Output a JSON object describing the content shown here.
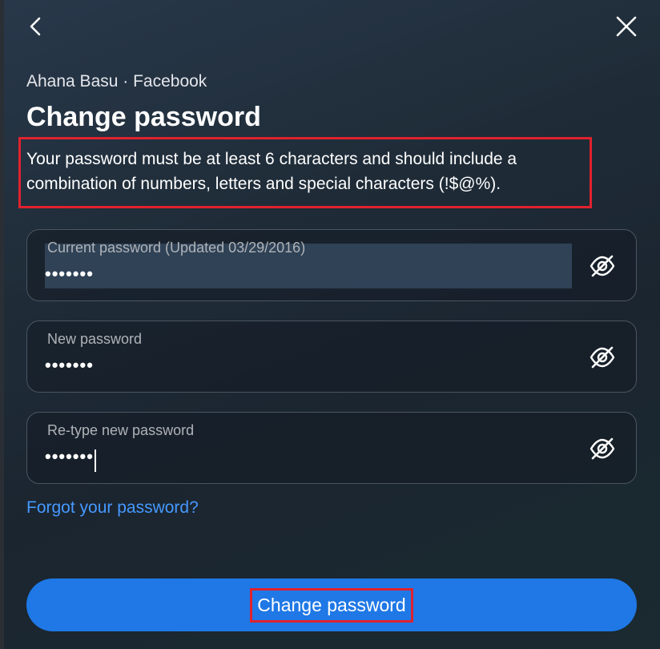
{
  "header": {
    "back_icon": "chevron-left-icon",
    "close_icon": "close-icon"
  },
  "account_line": "Ahana Basu · Facebook",
  "title": "Change password",
  "description": "Your password must be at least 6 characters and should include a combination of numbers, letters and special characters (!$@%).",
  "fields": [
    {
      "label": "Current password (Updated 03/29/2016)",
      "value": "•••••••",
      "icon": "eye-slash-icon"
    },
    {
      "label": "New password",
      "value": "•••••••",
      "icon": "eye-slash-icon"
    },
    {
      "label": "Re-type new password",
      "value": "•••••••",
      "icon": "eye-slash-icon"
    }
  ],
  "forgot_link": "Forgot your password?",
  "submit_label": "Change password",
  "colors": {
    "accent": "#1f78e6",
    "link": "#4599ff",
    "highlight_border": "#e0222e"
  }
}
